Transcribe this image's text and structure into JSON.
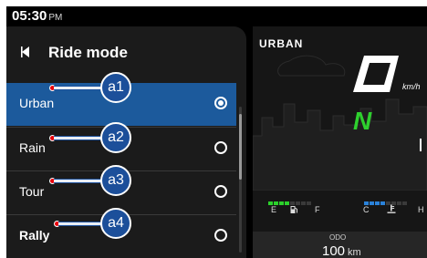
{
  "status_bar": {
    "time": "05:30",
    "ampm": "PM"
  },
  "menu": {
    "title": "Ride mode",
    "items": [
      {
        "label": "Urban",
        "selected": true
      },
      {
        "label": "Rain",
        "selected": false
      },
      {
        "label": "Tour",
        "selected": false
      },
      {
        "label": "Rally",
        "selected": false
      }
    ]
  },
  "callouts": [
    "a1",
    "a2",
    "a3",
    "a4"
  ],
  "dashboard": {
    "mode": "URBAN",
    "speed_unit": "km/h",
    "gear": "N",
    "fuel_labels": {
      "empty": "E",
      "full": "F"
    },
    "temp_labels": {
      "cold": "C",
      "hot": "H"
    },
    "odo_label": "ODO",
    "odo_value": "100",
    "odo_unit": "km"
  },
  "colors": {
    "selected_row": "#1c5a9c",
    "callout": "#1c4f9a",
    "gear": "#2ed02e",
    "gauge_fill": "#2bd12b",
    "temp_fill": "#2a82d9"
  },
  "icons": [
    "chevron-left-icon",
    "radio-icon",
    "fuel-pump-icon",
    "thermometer-icon"
  ]
}
